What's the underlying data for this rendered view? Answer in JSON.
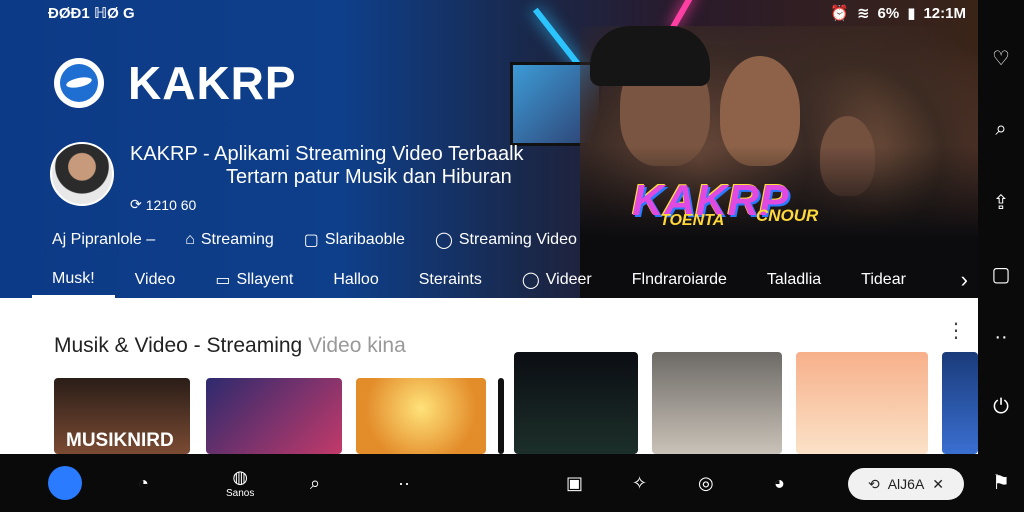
{
  "statusbar": {
    "left": "ÐØÐ1 ℍØ G",
    "battery": "6%",
    "time": "12:1M"
  },
  "hero": {
    "app_name": "KAKRP",
    "channel_title": "KAKRP - Aplikami Streaming Video Terbaalk",
    "channel_subtitle": "Tertarn patur Musik dan Hiburan",
    "channel_count": "1210 60",
    "meta": [
      {
        "icon": "none",
        "label": "Aj Pipranlole –"
      },
      {
        "icon": "home-icon",
        "label": "Streaming"
      },
      {
        "icon": "doc-icon",
        "label": "Slaribaoble"
      },
      {
        "icon": "chat-icon",
        "label": "Streaming Video"
      }
    ],
    "neon_text": "KAKRP",
    "neon_sub1": "TOENTA",
    "neon_sub2": "CNOUR"
  },
  "tabs": [
    {
      "label": "Musk!",
      "icon": "",
      "active": true
    },
    {
      "label": "Video",
      "icon": "",
      "active": false
    },
    {
      "label": "Sllayent",
      "icon": "chat",
      "active": false
    },
    {
      "label": "Halloo",
      "icon": "",
      "active": false
    },
    {
      "label": "Steraints",
      "icon": "",
      "active": false
    },
    {
      "label": "Videer",
      "icon": "chat",
      "active": false
    },
    {
      "label": "Flndraroiarde",
      "icon": "",
      "active": false
    },
    {
      "label": "Taladlia",
      "icon": "",
      "active": false
    },
    {
      "label": "Tidear",
      "icon": "",
      "active": false
    }
  ],
  "section": {
    "title": "Musik & Video - Streaming",
    "title_faded": "Video kina"
  },
  "cards": [
    {
      "overlay": "MUSIKNIRD",
      "colors": [
        "#2a1d18",
        "#7b4b33"
      ]
    },
    {
      "overlay": "",
      "colors": [
        "#2d2a6e",
        "#c23a6a"
      ]
    },
    {
      "overlay": "",
      "colors": [
        "#f4c84a",
        "#e38c2a"
      ]
    },
    {
      "overlay": "",
      "colors": [
        "#0b0d12",
        "#1c2f2a"
      ]
    },
    {
      "overlay": "",
      "colors": [
        "#6d6a66",
        "#c9c2b8"
      ]
    },
    {
      "overlay": "",
      "colors": [
        "#f7b08a",
        "#fbe2c8"
      ]
    },
    {
      "overlay": "",
      "colors": [
        "#1a3b7a",
        "#3a6fd1"
      ]
    }
  ],
  "bottomnav": {
    "badge_label": "Sanos",
    "pill_label": "AlJ6A"
  },
  "colors": {
    "accent": "#2a7bff",
    "hero_blue": "#0d3a86"
  }
}
